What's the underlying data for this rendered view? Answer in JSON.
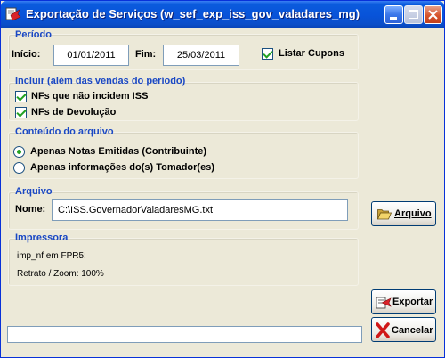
{
  "window": {
    "title": "Exportação de Serviços (w_sef_exp_iss_gov_valadares_mg)"
  },
  "periodo": {
    "title": "Período",
    "inicio_label": "Início:",
    "inicio_value": "01/01/2011",
    "fim_label": "Fim:",
    "fim_value": "25/03/2011",
    "listar_cupons_label": "Listar Cupons",
    "listar_cupons_checked": true
  },
  "incluir": {
    "title": "Incluir (além das vendas do período)",
    "options": [
      {
        "label": "NFs que não incidem ISS",
        "checked": true
      },
      {
        "label": "NFs de Devolução",
        "checked": true
      }
    ]
  },
  "conteudo": {
    "title": "Conteúdo do arquivo",
    "options": [
      {
        "label": "Apenas Notas Emitidas (Contribuinte)",
        "selected": true
      },
      {
        "label": "Apenas informações do(s) Tomador(es)",
        "selected": false
      }
    ]
  },
  "arquivo": {
    "title": "Arquivo",
    "nome_label": "Nome:",
    "nome_value": "C:\\ISS.GovernadorValadaresMG.txt",
    "button_label": "Arquivo",
    "button_icon": "folder-open-icon"
  },
  "impressora": {
    "title": "Impressora",
    "printer_line": "imp_nf em FPR5:",
    "zoom_line": "Retrato / Zoom: 100%"
  },
  "actions": {
    "exportar_label": "Exportar",
    "exportar_icon": "export-icon",
    "cancelar_label": "Cancelar",
    "cancelar_icon": "cancel-x-icon"
  },
  "colors": {
    "titlebar": "#0853d9",
    "group_title": "#1a48c4",
    "window_bg": "#ece9d8",
    "check": "#21a121"
  }
}
